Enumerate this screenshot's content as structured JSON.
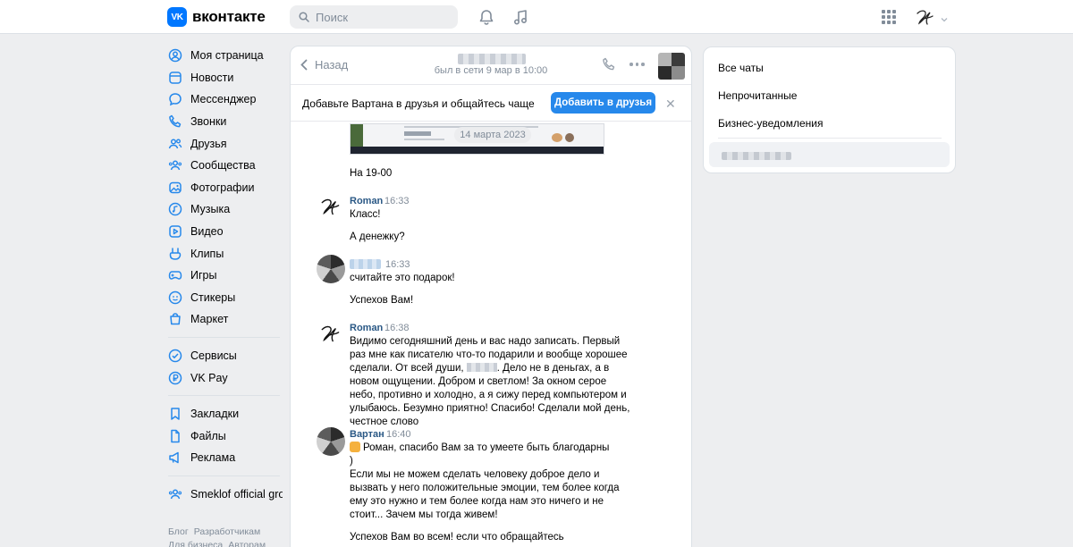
{
  "topbar": {
    "logo_mark": "VK",
    "logo_text": "вконтакте",
    "search_placeholder": "Поиск"
  },
  "sidebar": {
    "items": [
      {
        "label": "Моя страница",
        "icon": "profile-icon"
      },
      {
        "label": "Новости",
        "icon": "news-icon"
      },
      {
        "label": "Мессенджер",
        "icon": "messenger-icon"
      },
      {
        "label": "Звонки",
        "icon": "phone-icon"
      },
      {
        "label": "Друзья",
        "icon": "friends-icon"
      },
      {
        "label": "Сообщества",
        "icon": "communities-icon"
      },
      {
        "label": "Фотографии",
        "icon": "photos-icon"
      },
      {
        "label": "Музыка",
        "icon": "music-icon"
      },
      {
        "label": "Видео",
        "icon": "video-icon"
      },
      {
        "label": "Клипы",
        "icon": "clips-icon"
      },
      {
        "label": "Игры",
        "icon": "games-icon"
      },
      {
        "label": "Стикеры",
        "icon": "stickers-icon"
      },
      {
        "label": "Маркет",
        "icon": "market-icon"
      }
    ],
    "items2": [
      {
        "label": "Сервисы",
        "icon": "services-icon"
      },
      {
        "label": "VK Pay",
        "icon": "vkpay-icon"
      }
    ],
    "items3": [
      {
        "label": "Закладки",
        "icon": "bookmarks-icon"
      },
      {
        "label": "Файлы",
        "icon": "files-icon"
      },
      {
        "label": "Реклама",
        "icon": "ads-icon"
      }
    ],
    "items4": [
      {
        "label": "Smeklof official gro...",
        "icon": "group-icon"
      }
    ],
    "footer": [
      "Блог",
      "Разработчикам",
      "Для бизнеса",
      "Авторам"
    ]
  },
  "chat": {
    "back_label": "Назад",
    "status": "был в сети 9 мар в 10:00",
    "friend_prompt": "Добавьте Вартана в друзья и общайтесь чаще",
    "friend_button": "Добавить в друзья",
    "close_glyph": "✕",
    "date_chip": "14 марта 2023",
    "messages": [
      {
        "text": "На 19-00"
      },
      {
        "author": "Roman",
        "time": "16:33",
        "lines": [
          "Класс!",
          "А денежку?"
        ]
      },
      {
        "author": "",
        "time": "16:33",
        "lines": [
          "считайте это подарок!",
          "Успехов Вам!"
        ]
      },
      {
        "author": "Roman",
        "time": "16:38",
        "text_a": "Видимо сегодняшний день и вас надо записать. Первый раз мне как писателю что-то подарили и вообще хорошее сделали. От всей души,",
        "text_b": ". Дело не в деньгах, а в новом ощущении. Добром и светлом! За окном серое небо, противно и холодно, а я сижу перед компьютером и улыбаюсь. Безумно приятно! Спасибо! Сделали мой день, честное слово"
      },
      {
        "author": "Вартан",
        "time": "16:40",
        "line1": "Роман, спасибо Вам за то умеете быть благодарны",
        "line2": ")",
        "para": "Если мы не можем сделать человеку доброе дело и вызвать у него положительные эмоции, тем более когда ему это нужно и тем более когда нам это ничего и не стоит... Зачем мы тогда живем!",
        "last": "Успехов Вам во всем! если что обращайтесь"
      }
    ]
  },
  "rightpanel": {
    "items": [
      "Все чаты",
      "Непрочитанные",
      "Бизнес-уведомления"
    ]
  },
  "colors": {
    "accent": "#2688eb",
    "brand": "#0077ff",
    "author": "#2a5885",
    "muted": "#818c99",
    "background": "#edeef0"
  }
}
